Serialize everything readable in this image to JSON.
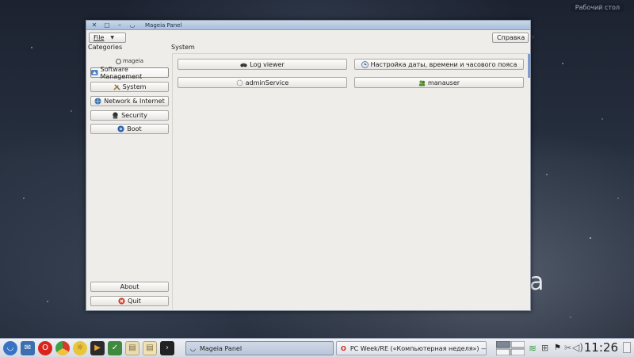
{
  "desktop": {
    "corner_label": "Рабочий стол",
    "wallpaper_text": "a"
  },
  "window": {
    "title": "Mageia Panel",
    "menus": {
      "file": "File",
      "help": "Справка"
    },
    "categories_label": "Categories",
    "section_label": "System",
    "logo_text": "mageia",
    "sidebar": {
      "software": "Software Management",
      "system": "System",
      "network": "Network & Internet",
      "security": "Security",
      "boot": "Boot",
      "about": "About",
      "quit": "Quit"
    },
    "tools": {
      "log_viewer": "Log viewer",
      "datetime": "Настройка даты, времени и часового пояса",
      "admin_service": "adminService",
      "manauser": "manauser"
    }
  },
  "taskbar": {
    "tasks": {
      "mageia": "Mageia Panel",
      "opera": "PC Week/RE («Компьютерная неделя») — Opera"
    },
    "clock": "11:26"
  },
  "colors": {
    "title_bar": "#b5c7e1",
    "window_bg": "#efedea",
    "accent": "#7d9bd0"
  }
}
